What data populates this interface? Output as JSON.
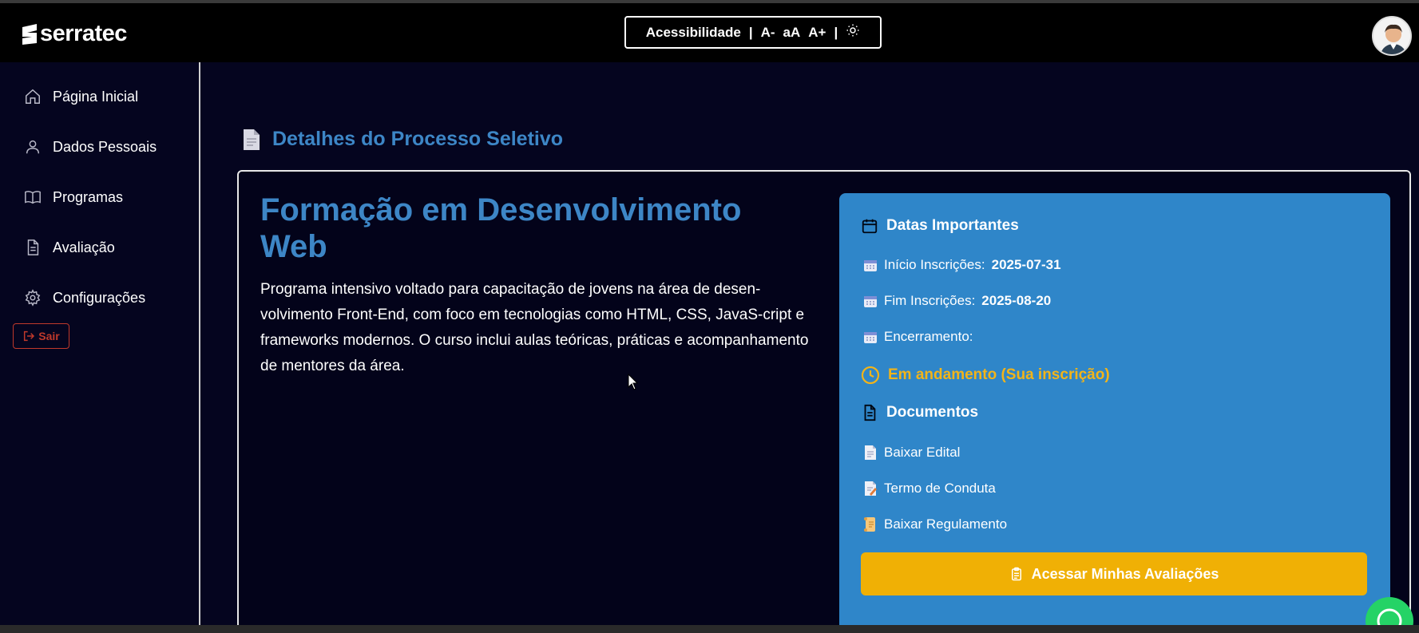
{
  "header": {
    "logo_text": "serratec",
    "accessibility": {
      "label": "Acessibilidade",
      "sep1": "|",
      "decrease": "A-",
      "reset": "aA",
      "increase": "A+",
      "sep2": "|",
      "theme_icon": "sun-icon"
    },
    "avatar_icon": "user-avatar"
  },
  "sidebar": {
    "items": [
      {
        "label": "Página Inicial",
        "icon": "home-icon"
      },
      {
        "label": "Dados Pessoais",
        "icon": "user-icon"
      },
      {
        "label": "Programas",
        "icon": "book-icon"
      },
      {
        "label": "Avaliação",
        "icon": "document-icon"
      },
      {
        "label": "Configurações",
        "icon": "gear-icon"
      }
    ],
    "logout_label": "Sair"
  },
  "main": {
    "page_title": "Detalhes do Processo Seletivo",
    "course_title": "Formação em Desenvolvimento Web",
    "course_description": "Programa intensivo voltado para capacitação de jovens na área de desen-volvimento Front-End, com foco em tecnologias como HTML, CSS, JavaS-cript e frameworks modernos. O curso inclui aulas teóricas, práticas e acompanhamento de mentores da área."
  },
  "panel": {
    "dates_heading": "Datas Importantes",
    "start_label": "Início Inscrições:",
    "start_value": "2025-07-31",
    "end_label": "Fim Inscrições:",
    "end_value": "2025-08-20",
    "closing_label": "Encerramento:",
    "status": "Em andamento (Sua inscrição)",
    "docs_heading": "Documentos",
    "docs": [
      {
        "label": "Baixar Edital"
      },
      {
        "label": "Termo de Conduta"
      },
      {
        "label": "Baixar Regulamento"
      }
    ],
    "cta_label": "Acessar Minhas Avaliações"
  },
  "colors": {
    "accent_blue": "#3d86c6",
    "panel_blue": "#2f86c9",
    "cta_yellow": "#f0b005",
    "status_yellow": "#f2b419",
    "background": "#05051f"
  }
}
